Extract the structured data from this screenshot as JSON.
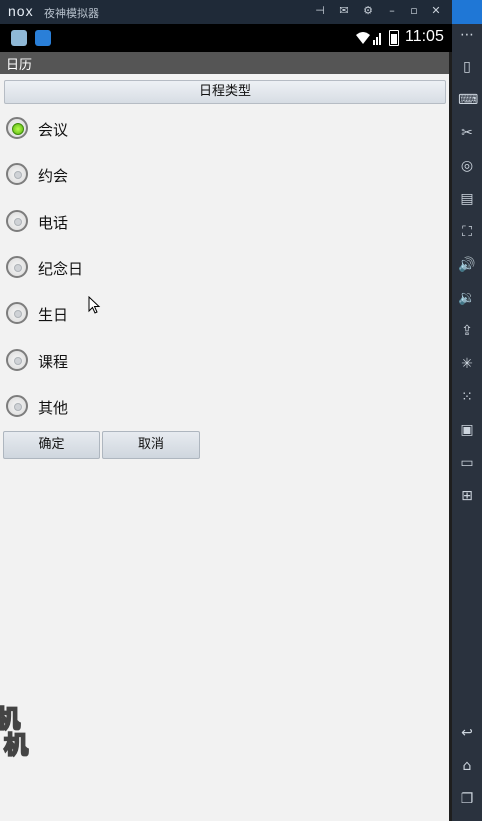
{
  "window": {
    "app_title": "夜神模拟器",
    "logo": "nox"
  },
  "statusbar": {
    "time": "11:05"
  },
  "actionbar": {
    "title": "日历"
  },
  "dialog": {
    "header": "日程类型",
    "options": [
      "会议",
      "约会",
      "电话",
      "纪念日",
      "生日",
      "课程",
      "其他"
    ],
    "selected_index": 0,
    "confirm_label": "确定",
    "cancel_label": "取消"
  },
  "watermark": {
    "line1": "机",
    "line2": "机"
  },
  "colors": {
    "accent": "#5cb811",
    "actionbar": "#555555",
    "sidebar": "#2a323e"
  }
}
